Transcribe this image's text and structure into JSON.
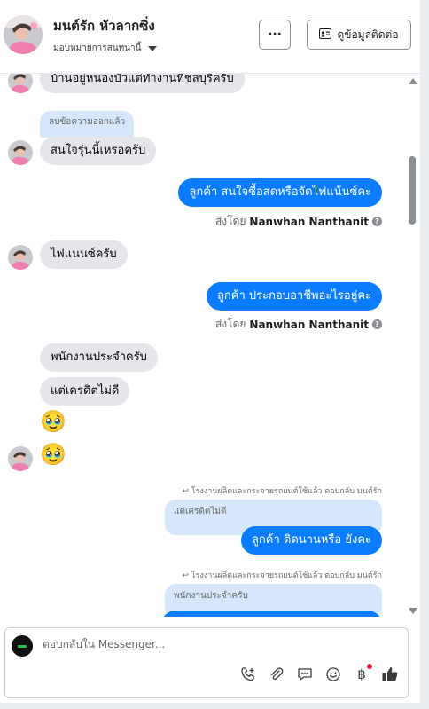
{
  "header": {
    "name": "มนต์รัก หัวลากซิ่ง",
    "assign_label": "มอบหมายการสนทนานี้",
    "more_label": "···",
    "contact_label": "ดูข้อมูลติดต่อ"
  },
  "messages": {
    "m1": "บ้านอยู่หนองบัวแต่ทำงานทีชลบุรีครับ",
    "deleted": "ลบข้อความออกแล้ว",
    "m2": "สนใจรุ่นนี้เหรอครับ",
    "m3": "ลูกค้า สนใจซื้อสดหรือจัดไฟแน้นซ์คะ",
    "m4": "ไฟแนนซ์ครับ",
    "m5": "ลูกค้า ประกอบอาชีพอะไรอยู่คะ",
    "m6": "พนักงานประจำครับ",
    "m7": "แต่เครดิตไม่ดี",
    "emoji1": "🥹",
    "emoji2": "🥹",
    "reply1_meta": "โรงงานผลิตและกระจายรถยนต์ใช้แล้ว ตอบกลับ มนต์รัก",
    "reply1_quote": "แต่เครดิตไม่ดี",
    "reply1_text": "ลูกค้า ติดนานหรือ ยังคะ",
    "reply2_meta": "โรงงานผลิตและกระจายรถยนต์ใช้แล้ว ตอบกลับ มนต์รัก",
    "reply2_quote": "พนักงานประจำครับ"
  },
  "sent_by": {
    "prefix": "ส่งโดย",
    "agent": "Nanwhan Nanthanit"
  },
  "composer": {
    "placeholder": "ตอบกลับใน Messenger..."
  },
  "icons": {
    "call": "phone-add-icon",
    "attach": "paperclip-icon",
    "saved_reply": "chat-bubble-icon",
    "emoji": "smiley-icon",
    "payment": "baht-icon",
    "like": "thumbs-up-icon"
  },
  "colors": {
    "outgoing": "#0a7cff",
    "incoming": "#e4e6eb",
    "quote": "#d6e7fb"
  }
}
